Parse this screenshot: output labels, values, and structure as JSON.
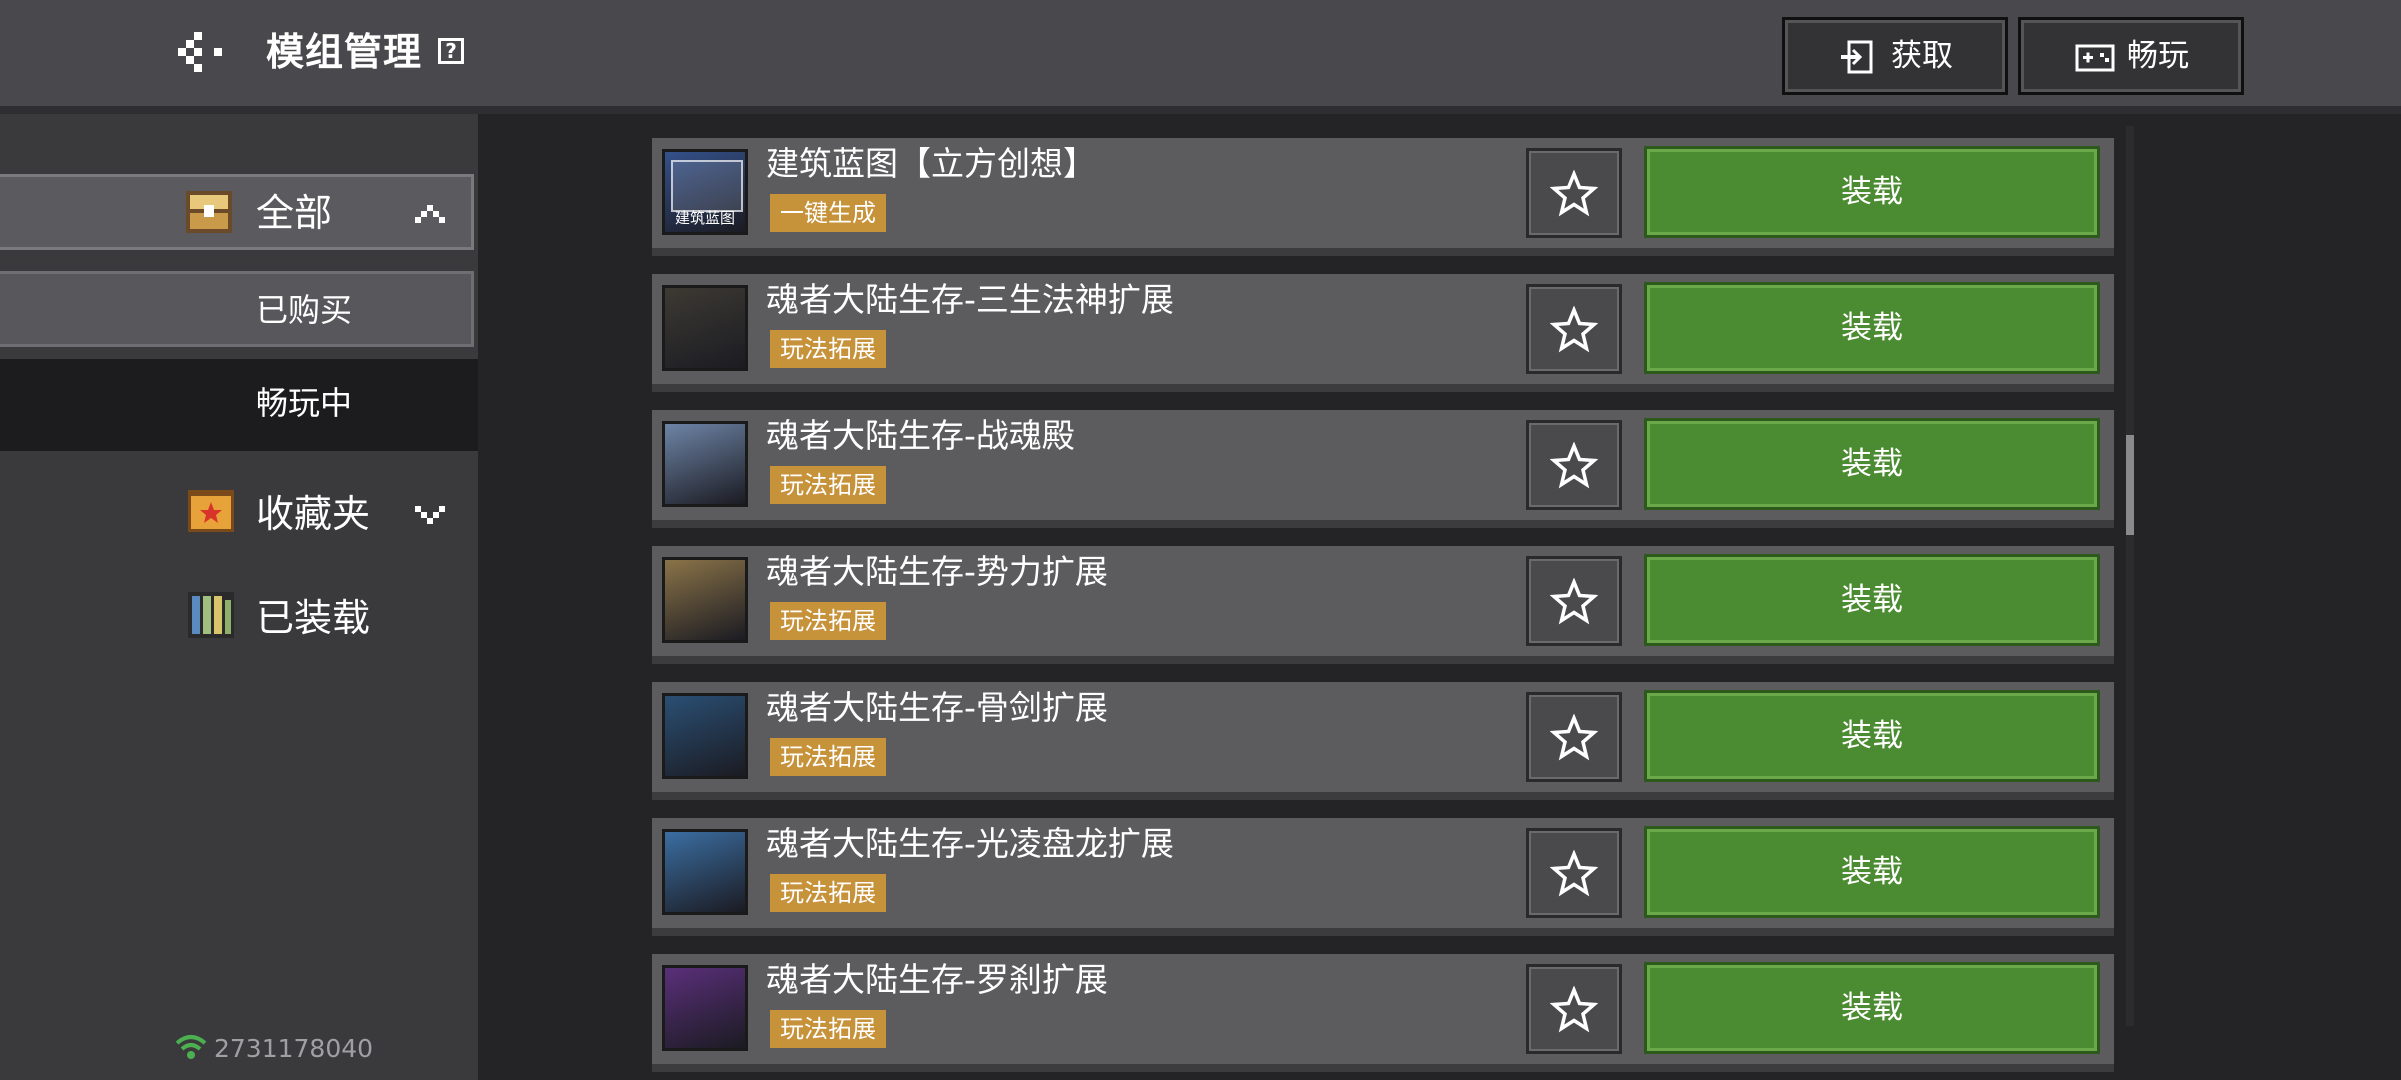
{
  "header": {
    "title": "模组管理",
    "help_icon": "question-box-icon",
    "get_label": "获取",
    "play_label": "畅玩"
  },
  "sidebar": {
    "all_label": "全部",
    "bought_label": "已购买",
    "playing_label": "畅玩中",
    "favorites_label": "收藏夹",
    "installed_label": "已装载",
    "account_id": "2731178040"
  },
  "mods": [
    {
      "name": "建筑蓝图【立方创想】",
      "tag": "一键生成",
      "thumb_label": "建筑蓝图",
      "action": "装载",
      "thumb_color": "#34518a"
    },
    {
      "name": "魂者大陆生存-三生法神扩展",
      "tag": "玩法拓展",
      "thumb_label": "",
      "action": "装载",
      "thumb_color": "#3d3a33"
    },
    {
      "name": "魂者大陆生存-战魂殿",
      "tag": "玩法拓展",
      "thumb_label": "",
      "action": "装载",
      "thumb_color": "#6d84a6"
    },
    {
      "name": "魂者大陆生存-势力扩展",
      "tag": "玩法拓展",
      "thumb_label": "",
      "action": "装载",
      "thumb_color": "#8a7348"
    },
    {
      "name": "魂者大陆生存-骨剑扩展",
      "tag": "玩法拓展",
      "thumb_label": "",
      "action": "装载",
      "thumb_color": "#2a4f74"
    },
    {
      "name": "魂者大陆生存-光凌盘龙扩展",
      "tag": "玩法拓展",
      "thumb_label": "",
      "action": "装载",
      "thumb_color": "#3b6ea2"
    },
    {
      "name": "魂者大陆生存-罗刹扩展",
      "tag": "玩法拓展",
      "thumb_label": "",
      "action": "装载",
      "thumb_color": "#5a2f7a"
    }
  ],
  "colors": {
    "load_button": "#4b8b31",
    "tag": "#c6923a",
    "row_bg": "#5c5c5e"
  }
}
